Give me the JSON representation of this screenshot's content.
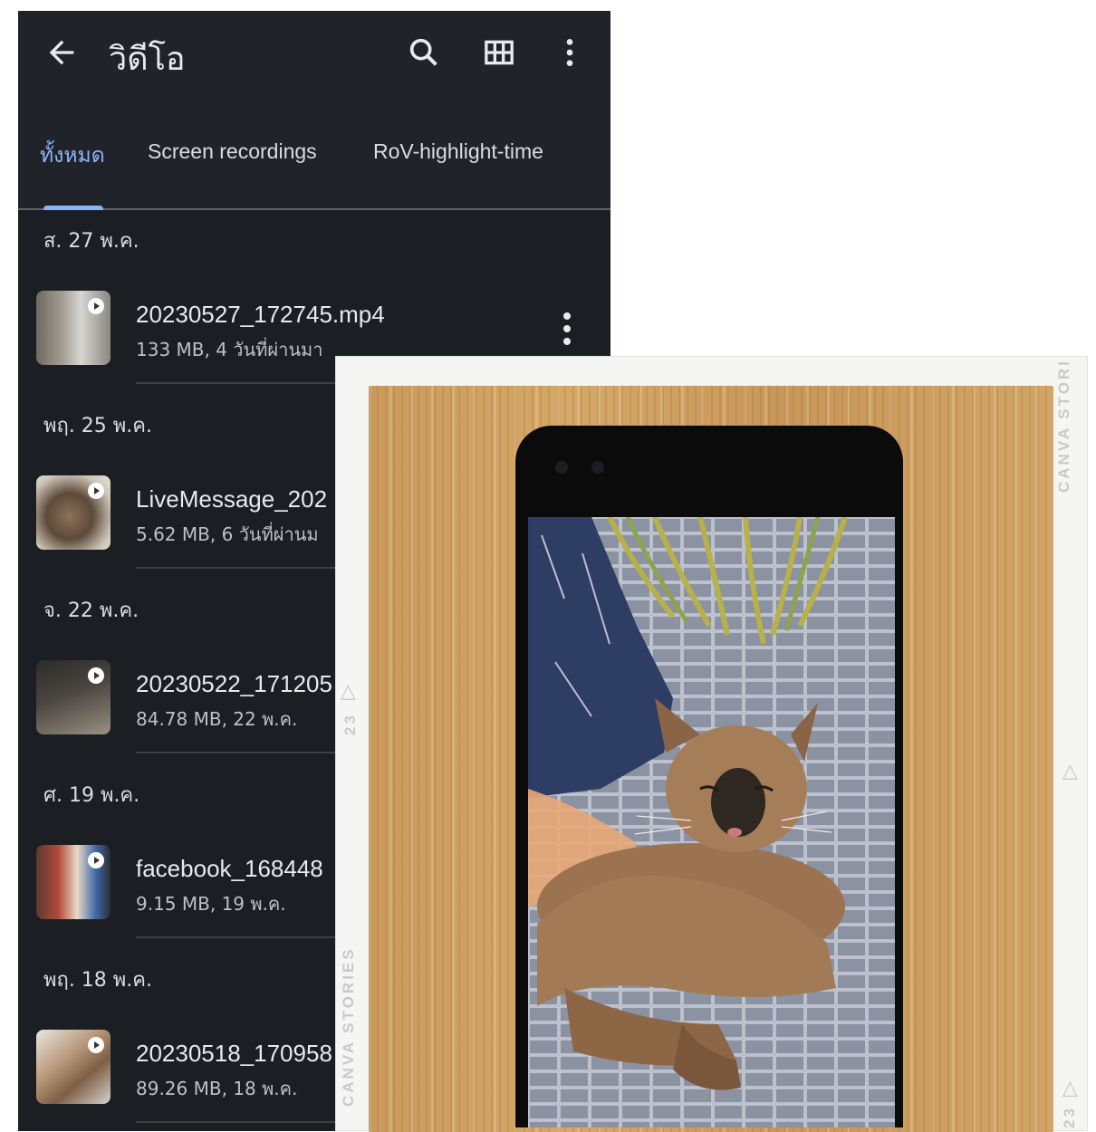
{
  "appbar": {
    "title": "วิดีโอ",
    "icons": [
      "back-arrow-icon",
      "search-icon",
      "grid-view-icon",
      "more-vert-icon"
    ]
  },
  "tabs": [
    {
      "label": "ทั้งหมด",
      "active": true
    },
    {
      "label": "Screen recordings",
      "active": false
    },
    {
      "label": "RoV-highlight-time",
      "active": false
    }
  ],
  "groups": [
    {
      "date": "ส. 27 พ.ค.",
      "name": "20230527_172745.mp4",
      "meta": "133 MB, 4 วันที่ผ่านมา"
    },
    {
      "date": "พฤ. 25 พ.ค.",
      "name": "LiveMessage_202",
      "meta": "5.62 MB, 6 วันที่ผ่านม"
    },
    {
      "date": "จ. 22 พ.ค.",
      "name": "20230522_171205",
      "meta": "84.78 MB, 22 พ.ค."
    },
    {
      "date": "ศ. 19 พ.ค.",
      "name": "facebook_168448",
      "meta": "9.15 MB, 19 พ.ค."
    },
    {
      "date": "พฤ. 18 พ.ค.",
      "name": "20230518_170958",
      "meta": "89.26 MB, 18 พ.ค."
    }
  ],
  "photo_card": {
    "watermark": "CANVA STORIES",
    "watermark_top_right": "CANVA STORI",
    "frame_number": "23",
    "frame_marker": "▷"
  },
  "colors": {
    "app_background": "#1b1f23",
    "active_tab": "#8ab4f8",
    "text_primary": "#e8eaed"
  }
}
